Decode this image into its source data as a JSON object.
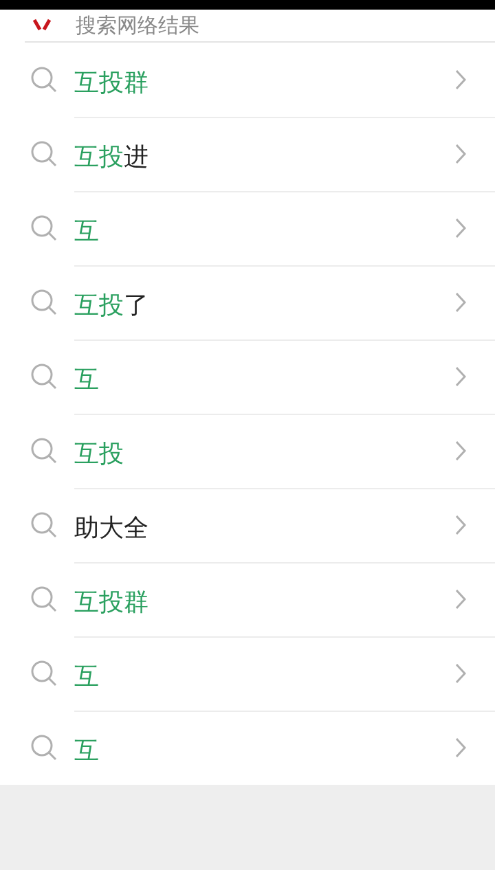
{
  "header": {
    "title": "搜索网络结果"
  },
  "results": [
    {
      "match": "互投群"
    },
    {
      "match": "互投",
      "rest": "进"
    },
    {
      "match": "互"
    },
    {
      "match": "互投",
      "rest": "了"
    },
    {
      "match": "互"
    },
    {
      "match": "互投"
    },
    {
      "rest": "助大全"
    },
    {
      "match": "互投群"
    },
    {
      "match": "互"
    },
    {
      "match": "互"
    }
  ]
}
